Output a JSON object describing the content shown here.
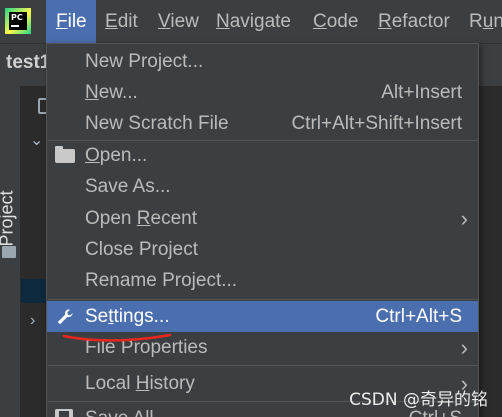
{
  "app": {
    "logo_text": "PC"
  },
  "menubar": {
    "items": [
      {
        "label_pre": "",
        "mnemonic": "F",
        "label_post": "ile"
      },
      {
        "label_pre": "",
        "mnemonic": "E",
        "label_post": "dit"
      },
      {
        "label_pre": "",
        "mnemonic": "V",
        "label_post": "iew"
      },
      {
        "label_pre": "",
        "mnemonic": "N",
        "label_post": "avigate"
      },
      {
        "label_pre": "",
        "mnemonic": "C",
        "label_post": "ode"
      },
      {
        "label_pre": "",
        "mnemonic": "R",
        "label_post": "efactor"
      },
      {
        "label_pre": "R",
        "mnemonic": "u",
        "label_post": "n"
      }
    ]
  },
  "project": {
    "name": "test1"
  },
  "toolwindow": {
    "project_label": "Project"
  },
  "file_menu": {
    "items": [
      {
        "pre": "New Project...",
        "mn": "",
        "post": "",
        "shortcut": ""
      },
      {
        "pre": "",
        "mn": "N",
        "post": "ew...",
        "shortcut": "Alt+Insert"
      },
      {
        "pre": "New Scratch File",
        "mn": "",
        "post": "",
        "shortcut": "Ctrl+Alt+Shift+Insert"
      },
      {
        "pre": "",
        "mn": "O",
        "post": "pen...",
        "shortcut": ""
      },
      {
        "pre": "Save As...",
        "mn": "",
        "post": "",
        "shortcut": ""
      },
      {
        "pre": "Open ",
        "mn": "R",
        "post": "ecent",
        "shortcut": ""
      },
      {
        "pre": "Close Project",
        "mn": "",
        "post": "",
        "shortcut": ""
      },
      {
        "pre": "Rename Project...",
        "mn": "",
        "post": "",
        "shortcut": ""
      },
      {
        "pre": "Se",
        "mn": "t",
        "post": "tings...",
        "shortcut": "Ctrl+Alt+S"
      },
      {
        "pre": "File Properties",
        "mn": "",
        "post": "",
        "shortcut": ""
      },
      {
        "pre": "Local ",
        "mn": "H",
        "post": "istory",
        "shortcut": ""
      },
      {
        "pre": "Save All",
        "mn": "",
        "post": "",
        "shortcut": "Ctrl+S"
      }
    ]
  },
  "watermark": "CSDN @奇异的铭",
  "colors": {
    "accent": "#4b6eaf",
    "menu_bg": "#3c3f41",
    "annotation": "#e8271f"
  }
}
